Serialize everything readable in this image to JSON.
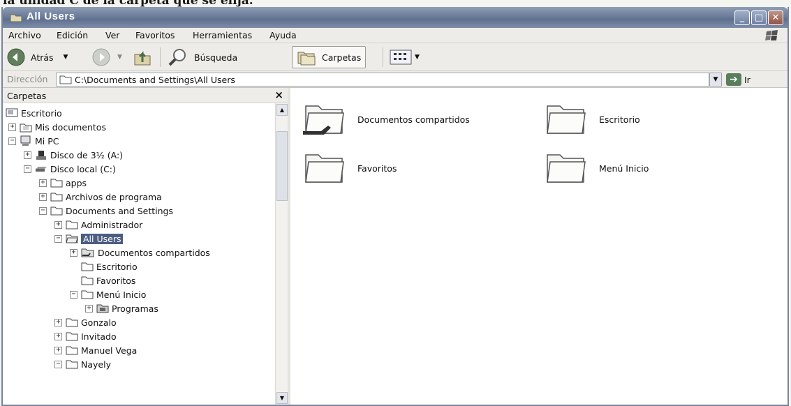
{
  "caption": "la unidad C de la carpeta que se elija.",
  "window": {
    "title": "All Users",
    "minimize_label": "_",
    "maximize_label": "□",
    "close_label": "✕"
  },
  "menu": [
    "Archivo",
    "Edición",
    "Ver",
    "Favoritos",
    "Herramientas",
    "Ayuda"
  ],
  "toolbar": {
    "back_label": "Atrás",
    "search_label": "Búsqueda",
    "folders_label": "Carpetas"
  },
  "address": {
    "label": "Dirección",
    "value": "C:\\Documents and Settings\\All Users",
    "go_label": "Ir"
  },
  "folder_pane": {
    "title": "Carpetas",
    "close_label": "×",
    "tree": [
      {
        "label": "Escritorio",
        "expander": "",
        "icon": "desktop-icon"
      },
      {
        "label": "Mis documentos",
        "expander": "+",
        "icon": "my-documents-icon"
      },
      {
        "label": "Mi PC",
        "expander": "−",
        "icon": "my-computer-icon"
      },
      {
        "label": "Disco de 3½ (A:)",
        "expander": "+",
        "icon": "floppy-drive-icon"
      },
      {
        "label": "Disco local (C:)",
        "expander": "−",
        "icon": "hard-drive-icon"
      },
      {
        "label": "apps",
        "expander": "+",
        "icon": "folder-icon"
      },
      {
        "label": "Archivos de programa",
        "expander": "+",
        "icon": "folder-icon"
      },
      {
        "label": "Documents and Settings",
        "expander": "−",
        "icon": "folder-icon"
      },
      {
        "label": "Administrador",
        "expander": "+",
        "icon": "folder-icon"
      },
      {
        "label": "All Users",
        "expander": "−",
        "icon": "open-folder-icon",
        "selected": true
      },
      {
        "label": "Documentos compartidos",
        "expander": "+",
        "icon": "shared-folder-icon"
      },
      {
        "label": "Escritorio",
        "expander": "",
        "icon": "folder-icon"
      },
      {
        "label": "Favoritos",
        "expander": "",
        "icon": "folder-icon"
      },
      {
        "label": "Menú Inicio",
        "expander": "−",
        "icon": "folder-icon"
      },
      {
        "label": "Programas",
        "expander": "+",
        "icon": "programs-folder-icon"
      },
      {
        "label": "Gonzalo",
        "expander": "+",
        "icon": "folder-icon"
      },
      {
        "label": "Invitado",
        "expander": "+",
        "icon": "folder-icon"
      },
      {
        "label": "Manuel Vega",
        "expander": "+",
        "icon": "folder-icon"
      },
      {
        "label": "Nayely",
        "expander": "−",
        "icon": "folder-icon"
      }
    ]
  },
  "content": {
    "items": [
      {
        "label": "Documentos compartidos",
        "icon": "shared-folder-icon"
      },
      {
        "label": "Escritorio",
        "icon": "folder-icon"
      },
      {
        "label": "Favoritos",
        "icon": "folder-icon"
      },
      {
        "label": "Menú Inicio",
        "icon": "folder-icon"
      }
    ]
  }
}
